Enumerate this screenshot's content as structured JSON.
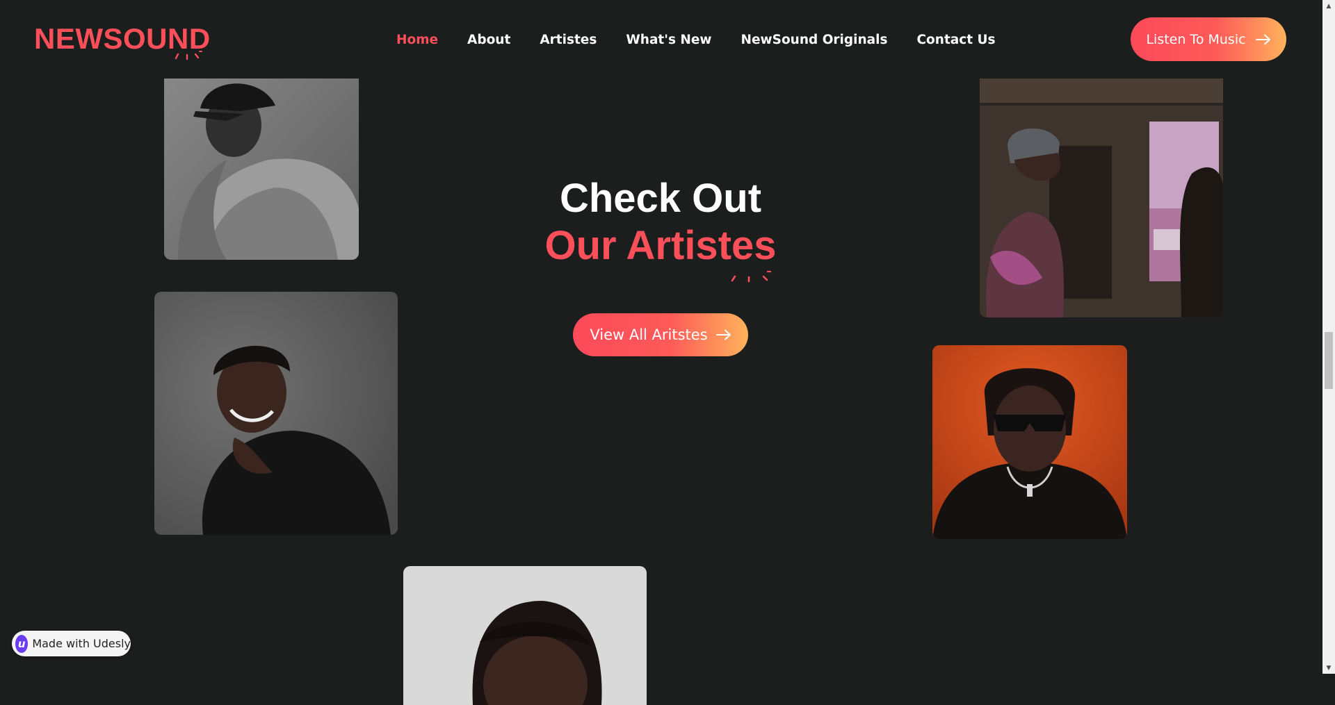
{
  "header": {
    "logo": "NEWSOUND",
    "nav": [
      {
        "label": "Home",
        "active": true
      },
      {
        "label": "About",
        "active": false
      },
      {
        "label": "Artistes",
        "active": false
      },
      {
        "label": "What's New",
        "active": false
      },
      {
        "label": "NewSound Originals",
        "active": false
      },
      {
        "label": "Contact Us",
        "active": false
      }
    ],
    "cta_label": "Listen To Music"
  },
  "hero": {
    "line1": "Check Out",
    "line2": "Our Artistes",
    "button_label": "View All Aritstes"
  },
  "artist_photos": [
    {
      "name": "artist-photo-cap",
      "tone": "grayscale"
    },
    {
      "name": "artist-photo-window",
      "tone": "warm-pink"
    },
    {
      "name": "artist-photo-smiling",
      "tone": "gray-backdrop"
    },
    {
      "name": "artist-photo-sunglasses",
      "tone": "orange-backdrop"
    },
    {
      "name": "artist-photo-bottom",
      "tone": "light-backdrop"
    }
  ],
  "badge": {
    "logo_letter": "u",
    "text": "Made with Udesly"
  },
  "colors": {
    "background": "#1c1d1d",
    "accent": "#fb4f5a",
    "gradient_end": "#ffb25c",
    "badge_logo": "#6a3df2"
  }
}
